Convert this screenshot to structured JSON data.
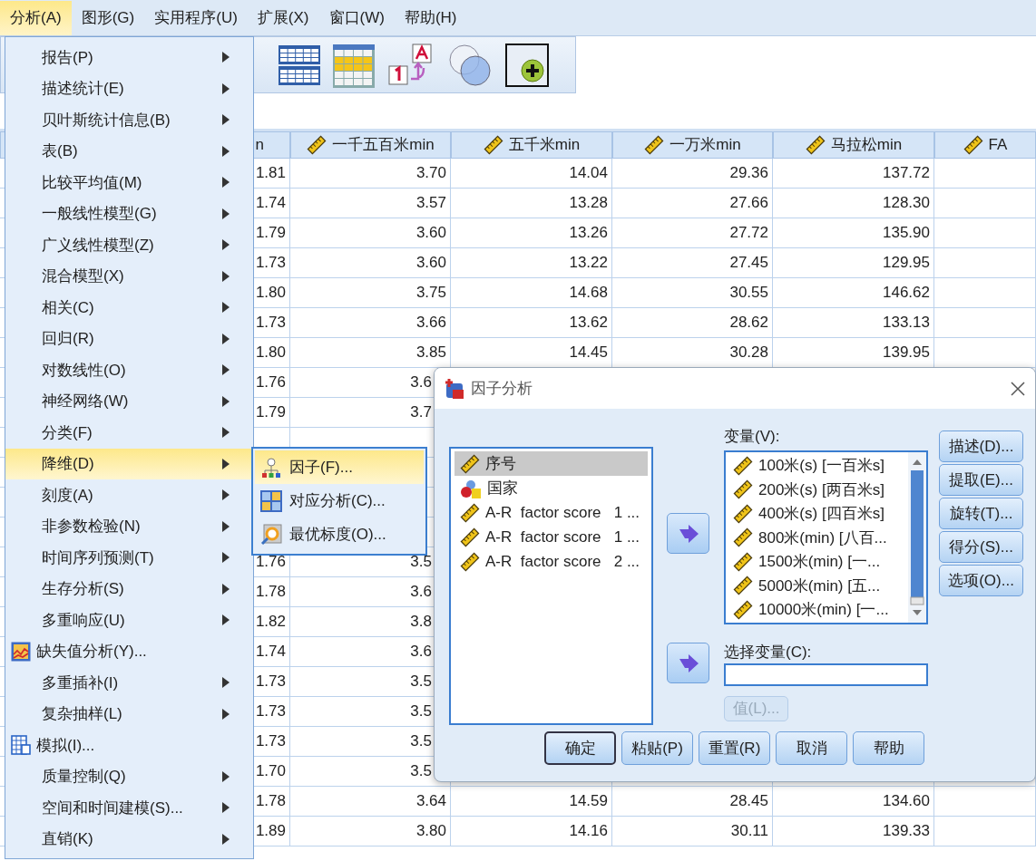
{
  "menubar": [
    {
      "label": "分析(A)",
      "selected": true
    },
    {
      "label": "图形(G)",
      "selected": false
    },
    {
      "label": "实用程序(U)",
      "selected": false
    },
    {
      "label": "扩展(X)",
      "selected": false
    },
    {
      "label": "窗口(W)",
      "selected": false
    },
    {
      "label": "帮助(H)",
      "selected": false
    }
  ],
  "table": {
    "columns": [
      {
        "label": "n",
        "kind": "cut"
      },
      {
        "label": "一千五百米min",
        "kind": "scale"
      },
      {
        "label": "五千米min",
        "kind": "scale"
      },
      {
        "label": "一万米min",
        "kind": "scale"
      },
      {
        "label": "马拉松min",
        "kind": "scale"
      },
      {
        "label": "FA",
        "kind": "scale"
      }
    ],
    "rows": [
      {
        "cells": [
          "1.81",
          "3.70",
          "14.04",
          "29.36",
          "137.72"
        ]
      },
      {
        "cells": [
          "1.74",
          "3.57",
          "13.28",
          "27.66",
          "128.30"
        ]
      },
      {
        "cells": [
          "1.79",
          "3.60",
          "13.26",
          "27.72",
          "135.90"
        ]
      },
      {
        "cells": [
          "1.73",
          "3.60",
          "13.22",
          "27.45",
          "129.95"
        ]
      },
      {
        "cells": [
          "1.80",
          "3.75",
          "14.68",
          "30.55",
          "146.62"
        ]
      },
      {
        "cells": [
          "1.73",
          "3.66",
          "13.62",
          "28.62",
          "133.13"
        ]
      },
      {
        "cells": [
          "1.80",
          "3.85",
          "14.45",
          "30.28",
          "139.95"
        ]
      },
      {
        "cells": [
          "1.76",
          "3.6"
        ]
      },
      {
        "cells": [
          "1.79",
          "3.7"
        ]
      },
      {
        "cells": [
          null,
          null
        ]
      },
      {
        "cells": [
          null,
          null
        ]
      },
      {
        "cells": [
          null,
          null
        ]
      },
      {
        "cells": [
          null,
          null
        ]
      },
      {
        "cells": [
          "1.76",
          "3.5"
        ]
      },
      {
        "cells": [
          "1.78",
          "3.6"
        ]
      },
      {
        "cells": [
          "1.82",
          "3.8"
        ]
      },
      {
        "cells": [
          "1.74",
          "3.6"
        ]
      },
      {
        "cells": [
          "1.73",
          "3.5"
        ]
      },
      {
        "cells": [
          "1.73",
          "3.5"
        ]
      },
      {
        "cells": [
          "1.73",
          "3.5"
        ]
      },
      {
        "cells": [
          "1.70",
          "3.5"
        ]
      },
      {
        "cells": [
          "1.78",
          "3.64",
          "14.59",
          "28.45",
          "134.60"
        ]
      },
      {
        "cells": [
          "1.89",
          "3.80",
          "14.16",
          "30.11",
          "139.33"
        ]
      }
    ]
  },
  "analyze_menu": {
    "items": [
      {
        "label": "报告(P)",
        "kind": "submenu",
        "selected": false
      },
      {
        "label": "描述统计(E)",
        "kind": "submenu",
        "selected": false
      },
      {
        "label": "贝叶斯统计信息(B)",
        "kind": "submenu",
        "selected": false
      },
      {
        "label": "表(B)",
        "kind": "submenu",
        "selected": false
      },
      {
        "label": "比较平均值(M)",
        "kind": "submenu",
        "selected": false
      },
      {
        "label": "一般线性模型(G)",
        "kind": "submenu",
        "selected": false
      },
      {
        "label": "广义线性模型(Z)",
        "kind": "submenu",
        "selected": false
      },
      {
        "label": "混合模型(X)",
        "kind": "submenu",
        "selected": false
      },
      {
        "label": "相关(C)",
        "kind": "submenu",
        "selected": false
      },
      {
        "label": "回归(R)",
        "kind": "submenu",
        "selected": false
      },
      {
        "label": "对数线性(O)",
        "kind": "submenu",
        "selected": false
      },
      {
        "label": "神经网络(W)",
        "kind": "submenu",
        "selected": false
      },
      {
        "label": "分类(F)",
        "kind": "submenu",
        "selected": false
      },
      {
        "label": "降维(D)",
        "kind": "submenu",
        "selected": true
      },
      {
        "label": "刻度(A)",
        "kind": "submenu",
        "selected": false
      },
      {
        "label": "非参数检验(N)",
        "kind": "submenu",
        "selected": false
      },
      {
        "label": "时间序列预测(T)",
        "kind": "submenu",
        "selected": false
      },
      {
        "label": "生存分析(S)",
        "kind": "submenu",
        "selected": false
      },
      {
        "label": "多重响应(U)",
        "kind": "submenu",
        "selected": false
      },
      {
        "label": "缺失值分析(Y)...",
        "kind": "dialog",
        "selected": false
      },
      {
        "label": "多重插补(I)",
        "kind": "submenu",
        "selected": false
      },
      {
        "label": "复杂抽样(L)",
        "kind": "submenu",
        "selected": false
      },
      {
        "label": "模拟(I)...",
        "kind": "dialog",
        "selected": false
      },
      {
        "label": "质量控制(Q)",
        "kind": "submenu",
        "selected": false
      },
      {
        "label": "空间和时间建模(S)...",
        "kind": "submenu",
        "selected": false
      },
      {
        "label": "直销(K)",
        "kind": "submenu",
        "selected": false
      }
    ]
  },
  "submenu": {
    "items": [
      {
        "label": "因子(F)...",
        "selected": true
      },
      {
        "label": "对应分析(C)...",
        "selected": false
      },
      {
        "label": "最优标度(O)...",
        "selected": false
      }
    ]
  },
  "dialog": {
    "title": "因子分析",
    "source_list": [
      {
        "label": "序号",
        "kind": "scale",
        "selected": true
      },
      {
        "label": "国家",
        "kind": "nominal",
        "selected": false
      },
      {
        "label": "A-R  factor score   1 ...",
        "kind": "scale",
        "selected": false
      },
      {
        "label": "A-R  factor score   1 ...",
        "kind": "scale",
        "selected": false
      },
      {
        "label": "A-R  factor score   2 ...",
        "kind": "scale",
        "selected": false
      }
    ],
    "variables_label": "变量(V):",
    "variables": [
      {
        "label": "100米(s) [一百米s]"
      },
      {
        "label": "200米(s) [两百米s]"
      },
      {
        "label": "400米(s) [四百米s]"
      },
      {
        "label": "800米(min) [八百..."
      },
      {
        "label": "1500米(min) [一..."
      },
      {
        "label": "5000米(min) [五..."
      },
      {
        "label": "10000米(min) [一..."
      }
    ],
    "selection_label": "选择变量(C):",
    "value_button": {
      "label": "值(L)...",
      "disabled": true
    },
    "side_buttons": [
      "描述(D)...",
      "提取(E)...",
      "旋转(T)...",
      "得分(S)...",
      "选项(O)..."
    ],
    "buttons": [
      {
        "label": "确定",
        "default": true
      },
      {
        "label": "粘贴(P)",
        "default": false
      },
      {
        "label": "重置(R)",
        "default": false
      },
      {
        "label": "取消",
        "default": false
      },
      {
        "label": "帮助",
        "default": false
      }
    ]
  }
}
